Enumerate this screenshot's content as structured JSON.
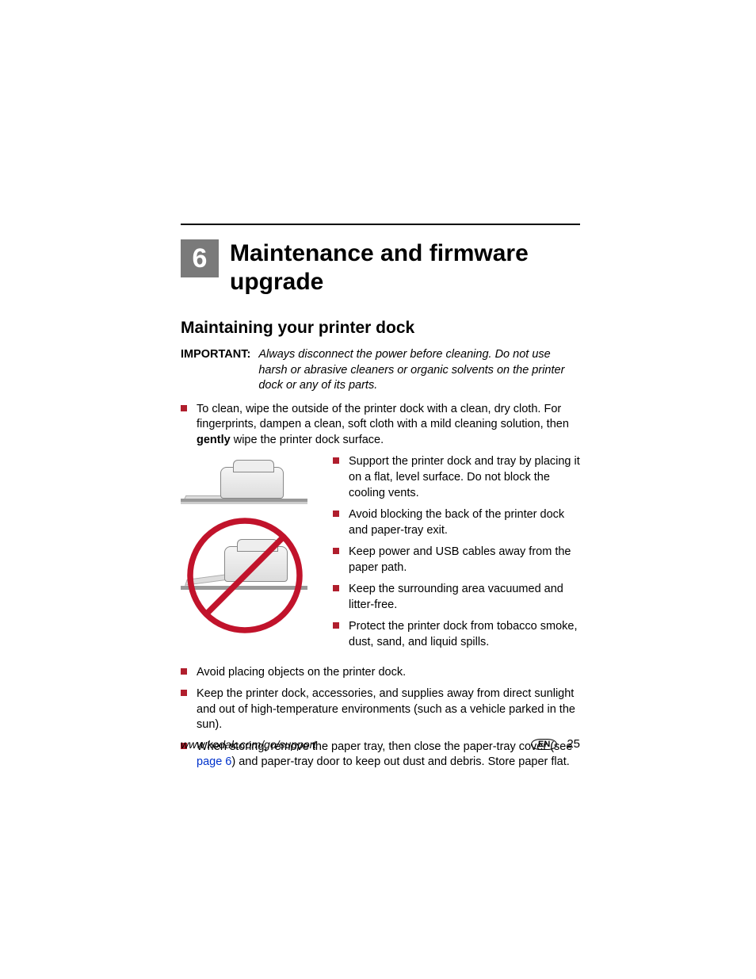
{
  "chapter": {
    "number": "6",
    "title": "Maintenance and firmware upgrade"
  },
  "section_title": "Maintaining your printer dock",
  "important": {
    "label": "IMPORTANT:",
    "text": "Always disconnect the power before cleaning. Do not use harsh or abrasive cleaners or organic solvents on the printer dock or any of its parts."
  },
  "bullet_clean": {
    "pre": "To clean, wipe the outside of the printer dock with a clean, dry cloth. For fingerprints, dampen a clean, soft cloth with a mild cleaning solution, then ",
    "bold": "gently",
    "post": " wipe the printer dock surface."
  },
  "side_bullets": [
    "Support the printer dock and tray by placing it on a flat, level surface. Do not block the cooling vents.",
    "Avoid blocking the back of the printer dock and paper-tray exit.",
    "Keep power and USB cables away from the paper path.",
    "Keep the surrounding area vacuumed and litter-free.",
    "Protect the printer dock from tobacco smoke, dust, sand, and liquid spills."
  ],
  "bottom_bullets": {
    "b0": "Avoid placing objects on the printer dock.",
    "b1": "Keep the printer dock, accessories, and supplies away from direct sunlight and out of high-temperature environments (such as a vehicle parked in the sun).",
    "b2_pre": "When storing, remove the paper tray, then close the paper-tray cover (see ",
    "b2_link": "page 6",
    "b2_post": ") and paper-tray door to keep out dust and debris. Store paper flat."
  },
  "footer": {
    "url": "www.kodak.com/go/support",
    "lang": "EN",
    "page": "25"
  }
}
